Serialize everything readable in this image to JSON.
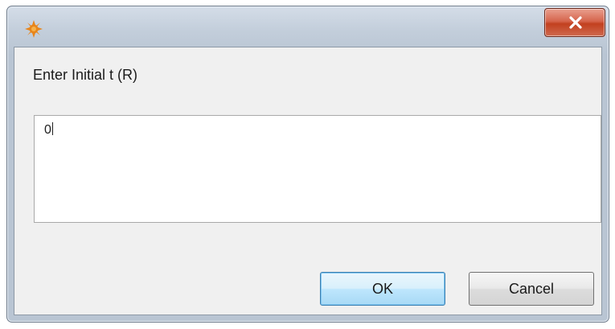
{
  "window": {
    "icon": "sunburst-icon",
    "close_label": "X"
  },
  "dialog": {
    "prompt": "Enter Initial t (R)",
    "input_value": "0"
  },
  "buttons": {
    "ok_label": "OK",
    "cancel_label": "Cancel"
  },
  "colors": {
    "close_button": "#c94a2c",
    "ok_border": "#3c7fb1",
    "client_bg": "#f0f0f0",
    "icon_orange": "#e8851a"
  }
}
